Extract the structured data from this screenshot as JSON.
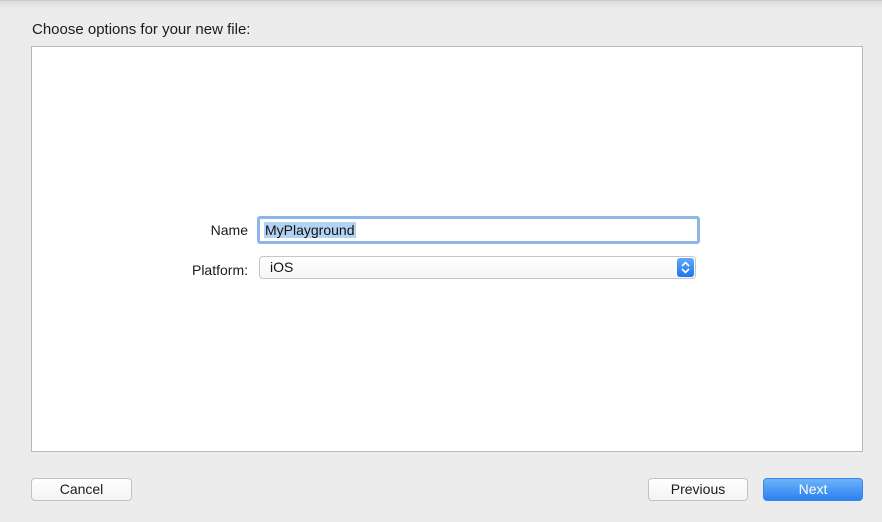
{
  "dialog": {
    "heading": "Choose options for your new file:"
  },
  "form": {
    "name_label": "Name",
    "name_value": "MyPlayground",
    "platform_label": "Platform:",
    "platform_value": "iOS"
  },
  "footer": {
    "cancel_label": "Cancel",
    "previous_label": "Previous",
    "next_label": "Next"
  },
  "colors": {
    "accent": "#2c80f0",
    "selection": "#b3d3f5",
    "focus_ring": "#8fb6e6"
  },
  "icons": {
    "platform_popup": "up-down-chevron-icon"
  }
}
